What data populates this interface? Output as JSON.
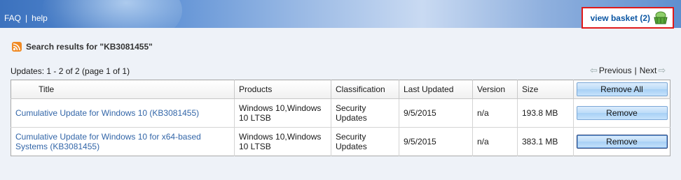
{
  "topnav": {
    "faq": "FAQ",
    "separator": "|",
    "help": "help"
  },
  "basket": {
    "label": "view basket (2)",
    "icon": "basket-icon"
  },
  "search": {
    "icon": "rss-icon",
    "title": "Search results for \"KB3081455\""
  },
  "summary": "Updates: 1 - 2 of 2 (page 1 of 1)",
  "pager": {
    "previous": "Previous",
    "separator": "|",
    "next": "Next"
  },
  "table": {
    "headers": [
      "Title",
      "Products",
      "Classification",
      "Last Updated",
      "Version",
      "Size"
    ],
    "remove_all": "Remove All",
    "rows": [
      {
        "title": "Cumulative Update for Windows 10 (KB3081455)",
        "products": "Windows 10,Windows 10 LTSB",
        "classification": "Security Updates",
        "last_updated": "9/5/2015",
        "version": "n/a",
        "size": "193.8 MB",
        "action": "Remove"
      },
      {
        "title": "Cumulative Update for Windows 10 for x64-based Systems (KB3081455)",
        "products": "Windows 10,Windows 10 LTSB",
        "classification": "Security Updates",
        "last_updated": "9/5/2015",
        "version": "n/a",
        "size": "383.1 MB",
        "action": "Remove"
      }
    ]
  }
}
